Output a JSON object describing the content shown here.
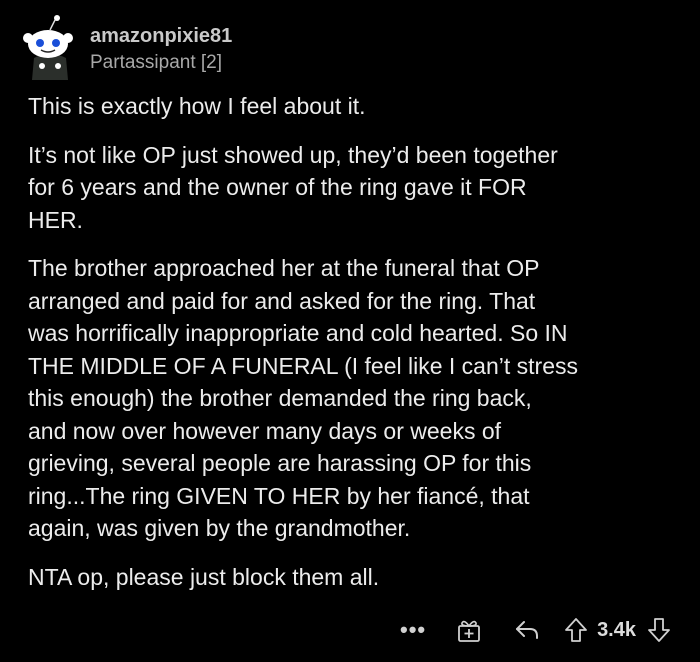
{
  "comment": {
    "author": {
      "username": "amazonpixie81",
      "flair": "Partassipant [2]",
      "avatar_icon": "snoo-avatar-icon"
    },
    "paragraphs": [
      "This is exactly how I feel about it.",
      "It’s not like OP just showed up, they’d been together\nfor 6 years and the owner of the ring gave it FOR\nHER.",
      "The brother approached her at the funeral that OP\narranged and paid for and asked for the ring. That\nwas horrifically inappropriate and cold hearted. So IN\nTHE MIDDLE OF A FUNERAL (I feel like I can’t stress\nthis enough) the brother demanded the ring back,\nand now over however many days or weeks of\ngrieving, several people are harassing OP for this\nring...The ring GIVEN TO HER by her fiancé, that\nagain, was given by the grandmother.",
      "NTA op, please just block them all."
    ],
    "actions": {
      "more_label": "•••",
      "award_icon": "award-icon",
      "reply_icon": "reply-icon",
      "upvote_icon": "upvote-icon",
      "score": "3.4k",
      "downvote_icon": "downvote-icon"
    }
  },
  "colors": {
    "background": "#000000",
    "text": "#ececec",
    "muted": "#a8a8a8"
  }
}
